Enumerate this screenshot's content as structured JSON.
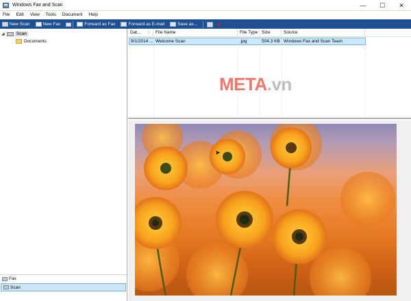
{
  "window": {
    "title": "Windows Fax and Scan",
    "minimize": "—",
    "maximize": "☐",
    "close": "✕"
  },
  "menu": [
    "File",
    "Edit",
    "View",
    "Tools",
    "Document",
    "Help"
  ],
  "toolbar": {
    "new_scan": "New Scan",
    "new_fax": "New Fax",
    "forward_fax": "Forward as Fax",
    "forward_email": "Forward as E-mail",
    "save_as": "Save as..."
  },
  "tree": {
    "root": "Scan",
    "child": "Documents"
  },
  "nav": {
    "fax": "Fax",
    "scan": "Scan"
  },
  "list": {
    "headers": {
      "date": "Dat...",
      "file_name": "File Name",
      "file_type": "File Type",
      "size": "Size",
      "source": "Source"
    },
    "row": {
      "date": "9/1/2014 ...",
      "file_name": "Welcome Scan",
      "file_type": ".jpg",
      "size": "504.3 KB",
      "source": "Windows Fax and Scan Team"
    }
  },
  "watermark": {
    "part1": "META",
    "part2": ".vn"
  },
  "colors": {
    "toolbar": "#1d4f91",
    "selection": "#cce8ff",
    "watermark": "#f0685e"
  }
}
